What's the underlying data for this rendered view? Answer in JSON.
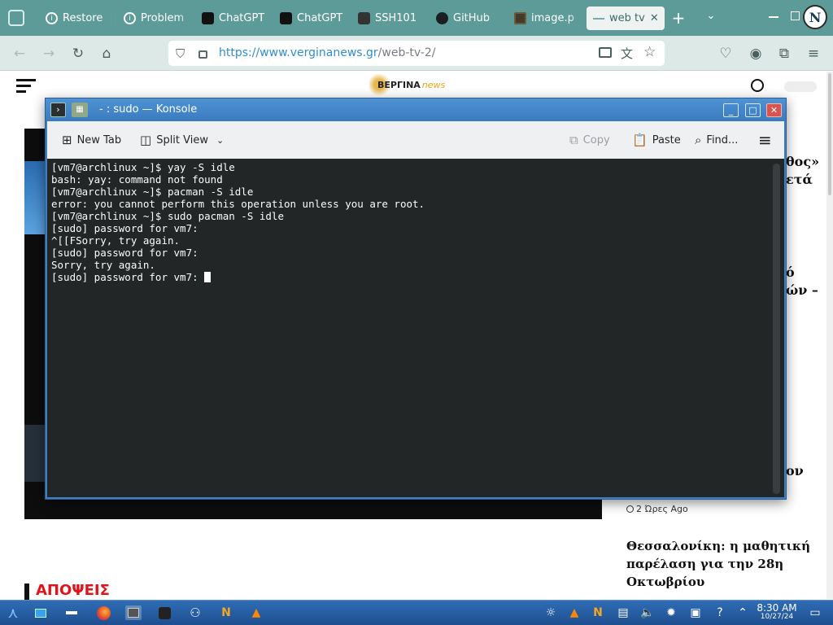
{
  "browser": {
    "tabs": [
      {
        "label": "Restore",
        "icon": "info-icon"
      },
      {
        "label": "Problem",
        "icon": "info-icon"
      },
      {
        "label": "ChatGPT",
        "icon": "chatgpt-icon"
      },
      {
        "label": "ChatGPT",
        "icon": "chatgpt-icon"
      },
      {
        "label": "SSH101",
        "icon": "ssh-icon"
      },
      {
        "label": "GitHub",
        "icon": "github-icon"
      },
      {
        "label": "image.p",
        "icon": "image-icon"
      },
      {
        "label": "web tv",
        "icon": "web-icon",
        "active": true
      }
    ],
    "url_host": "https://www.verginanews.gr",
    "url_path": "/web-tv-2/"
  },
  "website": {
    "logo_text": "ΒΕΡΓΙΝΑ",
    "logo_suffix": "news",
    "side_snippets": [
      "θος»",
      "ετά",
      "ό",
      "ών –",
      "ον"
    ],
    "article_time": "2 Ώρες Ago",
    "article_title_1": "Θεσσαλονίκη: η μαθητική",
    "article_title_2": "παρέλαση για την 28η",
    "article_title_3": "Οκτωβρίου",
    "section_opinion": "ΑΠΟΨΕΙΣ"
  },
  "konsole": {
    "title": "- : sudo — Konsole",
    "toolbar": {
      "new_tab": "New Tab",
      "split_view": "Split View",
      "copy": "Copy",
      "paste": "Paste",
      "find": "Find..."
    },
    "lines": [
      "[vm7@archlinux ~]$ yay -S idle",
      "bash: yay: command not found",
      "[vm7@archlinux ~]$ pacman -S idle",
      "error: you cannot perform this operation unless you are root.",
      "[vm7@archlinux ~]$ sudo pacman -S idle",
      "[sudo] password for vm7:",
      "^[[FSorry, try again.",
      "[sudo] password for vm7:",
      "Sorry, try again."
    ],
    "prompt_line": "[sudo] password for vm7: "
  },
  "taskbar": {
    "time": "8:30 AM",
    "date": "10/27/24"
  },
  "colors": {
    "tabstrip": "#5d9b98",
    "navbar": "#dce9e7",
    "konsole_title": "#3f7fbf",
    "terminal_bg": "#232627",
    "taskbar": "#2f6db5",
    "opinion_red": "#e0151b"
  }
}
